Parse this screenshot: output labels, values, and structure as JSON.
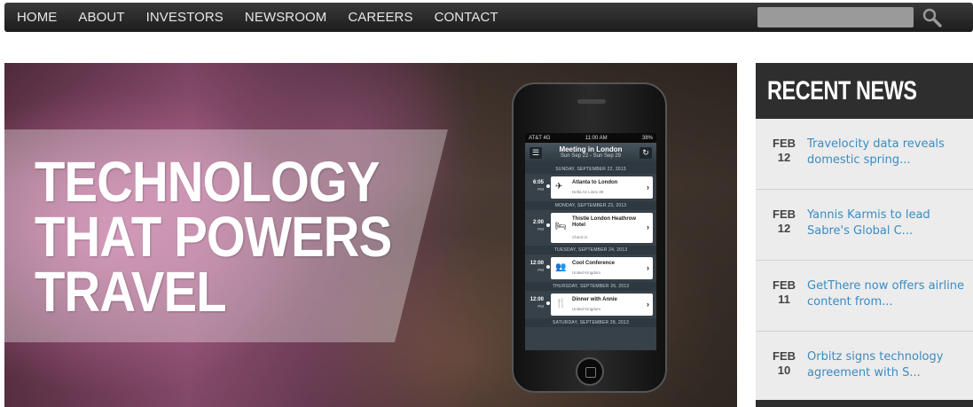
{
  "nav": {
    "items": [
      "HOME",
      "ABOUT",
      "INVESTORS",
      "NEWSROOM",
      "CAREERS",
      "CONTACT"
    ],
    "search_placeholder": ""
  },
  "hero": {
    "headline_lines": [
      "TECHNOLOGY",
      "THAT POWERS",
      "TRAVEL"
    ],
    "phone": {
      "carrier": "AT&T 4G",
      "time": "11:00 AM",
      "battery": "38%",
      "title": "Meeting in London",
      "dates": "Sun Sep 22 - Sun Sep 29",
      "days": [
        {
          "heading": "SUNDAY, SEPTEMBER 22, 2013",
          "events": [
            {
              "time": "6:05",
              "ampm": "PM",
              "icon": "airplane-icon",
              "title": "Atlanta to London",
              "sub": "Delta Air Lines 38"
            }
          ]
        },
        {
          "heading": "MONDAY, SEPTEMBER 23, 2013",
          "events": [
            {
              "time": "2:00",
              "ampm": "PM",
              "icon": "bed-icon",
              "title": "Thistle London Heathrow Hotel",
              "sub": "Check in"
            }
          ]
        },
        {
          "heading": "TUESDAY, SEPTEMBER 24, 2013",
          "events": [
            {
              "time": "12:00",
              "ampm": "PM",
              "icon": "people-icon",
              "title": "Cool Conference",
              "sub": "United Kingdom"
            }
          ]
        },
        {
          "heading": "THURSDAY, SEPTEMBER 26, 2013",
          "events": [
            {
              "time": "12:00",
              "ampm": "PM",
              "icon": "dining-icon",
              "title": "Dinner with Annie",
              "sub": "United Kingdom"
            }
          ]
        },
        {
          "heading": "SATURDAY, SEPTEMBER 28, 2013",
          "events": []
        }
      ]
    }
  },
  "news": {
    "heading": "RECENT NEWS",
    "items": [
      {
        "month": "FEB",
        "day": "12",
        "title": "Travelocity data reveals domestic spring..."
      },
      {
        "month": "FEB",
        "day": "12",
        "title": "Yannis Karmis to lead Sabre's Global C..."
      },
      {
        "month": "FEB",
        "day": "11",
        "title": "GetThere now offers airline content from..."
      },
      {
        "month": "FEB",
        "day": "10",
        "title": "Orbitz signs technology agreement with S..."
      }
    ]
  },
  "colors": {
    "nav_bg": "#262626",
    "news_header_bg": "#2e2e2e",
    "news_link": "#3a8cc2",
    "hero_pink": "#b4608c"
  }
}
